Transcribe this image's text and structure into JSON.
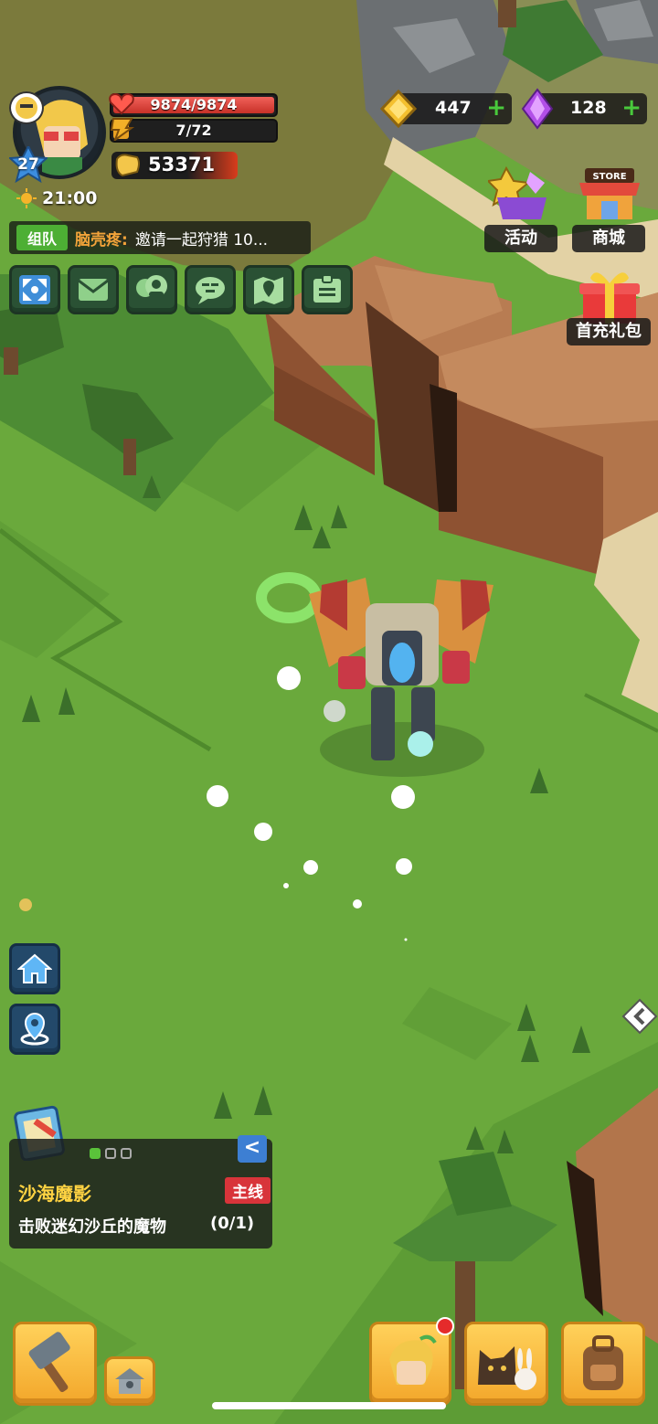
{
  "player": {
    "level": "27",
    "hp": "9874/9874",
    "hp_fraction": 1.0,
    "stamina": "7/72",
    "stamina_fraction": 0.097,
    "combat_power": "53371",
    "time": "21:00"
  },
  "team_chat": {
    "tag": "组队",
    "sender": "脑壳疼:",
    "message": "邀请一起狩猎 10..."
  },
  "function_buttons": [
    {
      "icon": "expand-icon"
    },
    {
      "icon": "mail-icon"
    },
    {
      "icon": "friends-icon"
    },
    {
      "icon": "chat-icon"
    },
    {
      "icon": "map-icon"
    },
    {
      "icon": "id-card-icon"
    }
  ],
  "currency": {
    "gold": "447",
    "gems": "128"
  },
  "right_buttons": {
    "activity": "活动",
    "store_sign": "STORE",
    "store": "商城",
    "first_recharge": "首充礼包"
  },
  "quest": {
    "title": "沙海魔影",
    "tag": "主线",
    "description": "击败迷幻沙丘的魔物",
    "progress": "(0/1)",
    "collapse_glyph": "<",
    "page_dots": 3,
    "active_dot": 0
  },
  "colors": {
    "grass": "#6aa93c",
    "cliff": "#a8683f",
    "hp": "#e2443b",
    "accent_green": "#4daf34",
    "quest_title": "#ffd342",
    "quest_tag": "#d8343a"
  }
}
